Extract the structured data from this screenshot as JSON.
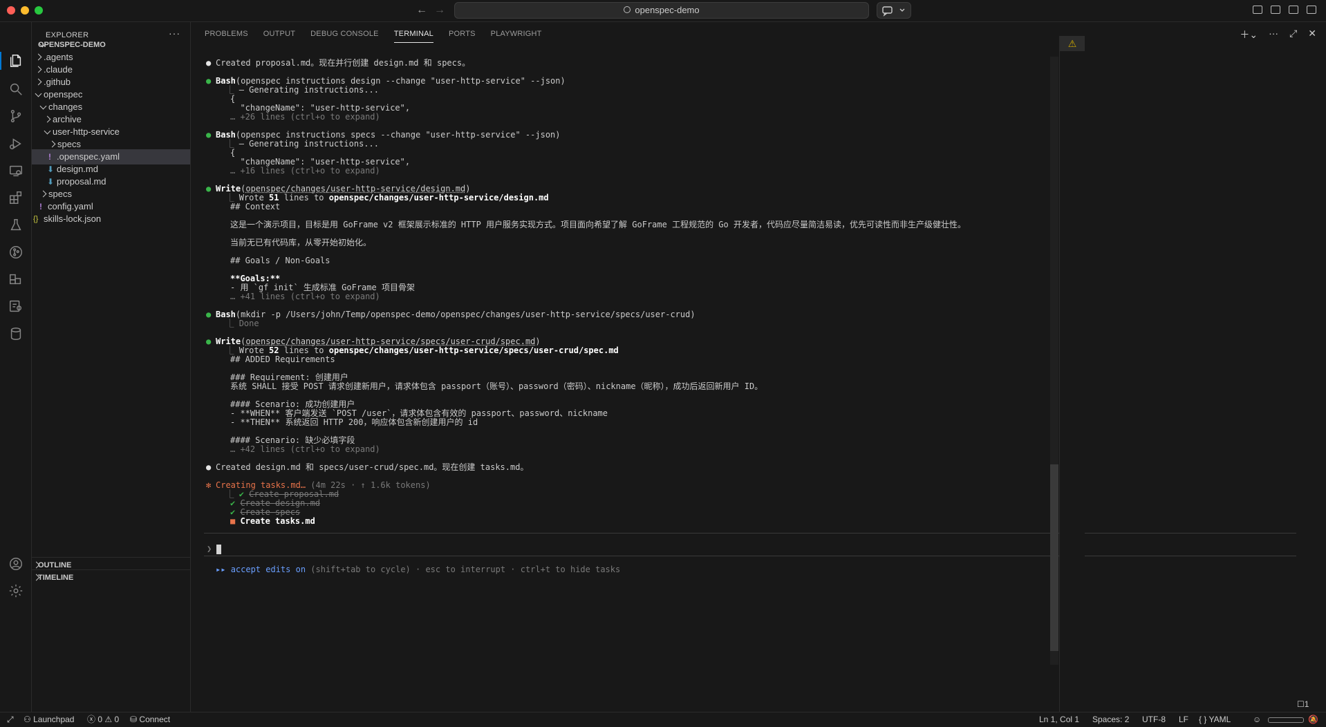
{
  "titlebar": {
    "search_text": "openspec-demo"
  },
  "activity": {
    "icons": [
      "files-icon",
      "search-icon",
      "source-control-icon",
      "run-debug-icon",
      "remote-explorer-icon",
      "extensions-icon",
      "testing-icon",
      "git-graph-icon",
      "containers-icon",
      "github-icon",
      "database-icon",
      "account-icon",
      "settings-gear-icon"
    ]
  },
  "explorer": {
    "header": "EXPLORER",
    "root": "OPENSPEC-DEMO",
    "items": [
      {
        "label": ".agents"
      },
      {
        "label": ".claude"
      },
      {
        "label": ".github"
      },
      {
        "label": "openspec"
      },
      {
        "label": "changes"
      },
      {
        "label": "archive"
      },
      {
        "label": "user-http-service"
      },
      {
        "label": "specs"
      },
      {
        "label": ".openspec.yaml"
      },
      {
        "label": "design.md"
      },
      {
        "label": "proposal.md"
      },
      {
        "label": "specs"
      },
      {
        "label": "config.yaml"
      },
      {
        "label": "skills-lock.json"
      }
    ],
    "outline": "OUTLINE",
    "timeline": "TIMELINE"
  },
  "panel": {
    "tabs": [
      "PROBLEMS",
      "OUTPUT",
      "DEBUG CONSOLE",
      "TERMINAL",
      "PORTS",
      "PLAYWRIGHT"
    ],
    "active_tab": "TERMINAL"
  },
  "terminal": {
    "l1": "Created proposal.md。现在并行创建 design.md 和 specs。",
    "b1_tool": "Bash",
    "b1_cmd": "(openspec instructions design --change \"user-http-service\" --json)",
    "b1_o1": "– Generating instructions...",
    "b1_o2": "{",
    "b1_o3": "  \"changeName\": \"user-http-service\",",
    "b1_more": "… +26 lines (ctrl+o to expand)",
    "b2_tool": "Bash",
    "b2_cmd": "(openspec instructions specs --change \"user-http-service\" --json)",
    "b2_o1": "– Generating instructions...",
    "b2_o2": "{",
    "b2_o3": "  \"changeName\": \"user-http-service\",",
    "b2_more": "… +16 lines (ctrl+o to expand)",
    "w1_tool": "Write",
    "w1_path": "openspec/changes/user-http-service/design.md",
    "w1_wrote_pre": "Wrote ",
    "w1_count": "51",
    "w1_wrote_mid": " lines to ",
    "w1_target": "openspec/changes/user-http-service/design.md",
    "w1_c1": "## Context",
    "w1_c2": "这是一个演示项目，目标是用 GoFrame v2 框架展示标准的 HTTP 用户服务实现方式。项目面向希望了解 GoFrame 工程规范的 Go 开发者，代码应尽量简洁易读，优先可读性而非生产级健壮性。",
    "w1_c3": "当前无已有代码库，从零开始初始化。",
    "w1_c4": "## Goals / Non-Goals",
    "w1_c5": "**Goals:**",
    "w1_c6": "- 用 `gf init` 生成标准 GoFrame 项目骨架",
    "w1_more": "… +41 lines (ctrl+o to expand)",
    "b3_tool": "Bash",
    "b3_cmd": "(mkdir -p /Users/john/Temp/openspec-demo/openspec/changes/user-http-service/specs/user-crud)",
    "b3_o1": "Done",
    "w2_tool": "Write",
    "w2_path": "openspec/changes/user-http-service/specs/user-crud/spec.md",
    "w2_wrote_pre": "Wrote ",
    "w2_count": "52",
    "w2_wrote_mid": " lines to ",
    "w2_target": "openspec/changes/user-http-service/specs/user-crud/spec.md",
    "w2_c1": "## ADDED Requirements",
    "w2_c2": "### Requirement: 创建用户",
    "w2_c3": "系统 SHALL 接受 POST 请求创建新用户，请求体包含 passport（账号）、password（密码）、nickname（昵称），成功后返回新用户 ID。",
    "w2_c4": "#### Scenario: 成功创建用户",
    "w2_c5": "- **WHEN** 客户端发送 `POST /user`，请求体包含有效的 passport、password、nickname",
    "w2_c6": "- **THEN** 系统返回 HTTP 200，响应体包含新创建用户的 id",
    "w2_c7": "#### Scenario: 缺少必填字段",
    "w2_more": "… +42 lines (ctrl+o to expand)",
    "l2": "Created design.md 和 specs/user-crud/spec.md。现在创建 tasks.md。",
    "task_title": "Creating tasks.md…",
    "task_meta": " (4m 22s · ↑ 1.6k tokens)",
    "task1": "Create proposal.md",
    "task2": "Create design.md",
    "task3": "Create specs",
    "task4": "Create tasks.md",
    "prompt": "❯",
    "mode_arrows": "▸▸",
    "mode_label": "accept edits on",
    "mode_hint": " (shift+tab to cycle) · esc to interrupt · ctrl+t to hide tasks"
  },
  "status": {
    "remote": "Launchpad",
    "errors": "0",
    "warnings": "0",
    "connect": "Connect",
    "position": "Ln 1, Col 1",
    "spaces": "Spaces: 2",
    "encoding": "UTF-8",
    "eol": "LF",
    "language": "YAML",
    "notifications": "1"
  }
}
